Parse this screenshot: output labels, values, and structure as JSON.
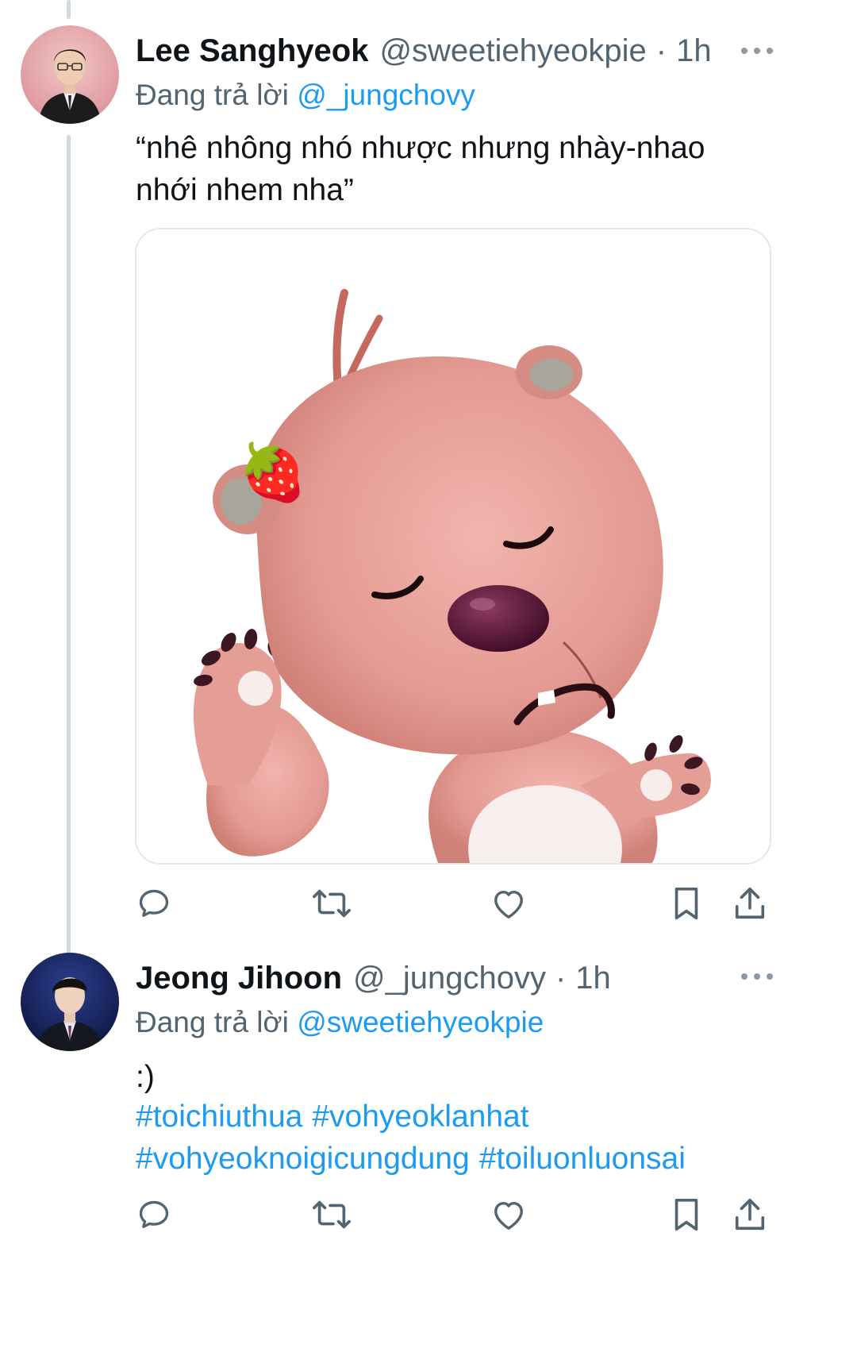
{
  "tweets": [
    {
      "display_name": "Lee Sanghyeok",
      "handle": "@sweetiehyeokpie",
      "separator": "·",
      "time": "1h",
      "reply_prefix": "Đang trả lời",
      "reply_to": "@_jungchovy",
      "text": "“nhê nhông nhó nhược nhưng nhày-nhao\nnhới nhem nha”",
      "has_media": true,
      "media_emoji": "🍓",
      "avatar_icon": "person-in-black-suit"
    },
    {
      "display_name": "Jeong Jihoon",
      "handle": "@_jungchovy",
      "separator": "·",
      "time": "1h",
      "reply_prefix": "Đang trả lời",
      "reply_to": "@sweetiehyeokpie",
      "text": ":)",
      "hashtags": [
        "#toichiuthua",
        "#vohyeoklanhat",
        "#vohyeoknoigicungdung",
        "#toiluonluonsai"
      ],
      "avatar_icon": "person-in-dark-suit"
    }
  ],
  "actions": [
    "reply-icon",
    "retweet-icon",
    "like-icon",
    "bookmark-icon",
    "share-icon"
  ],
  "colors": {
    "link": "#1d9bf0",
    "secondary_text": "#536471",
    "primary_text": "#0f1419",
    "thread_line": "#cfd9de",
    "icon": "#536471"
  }
}
